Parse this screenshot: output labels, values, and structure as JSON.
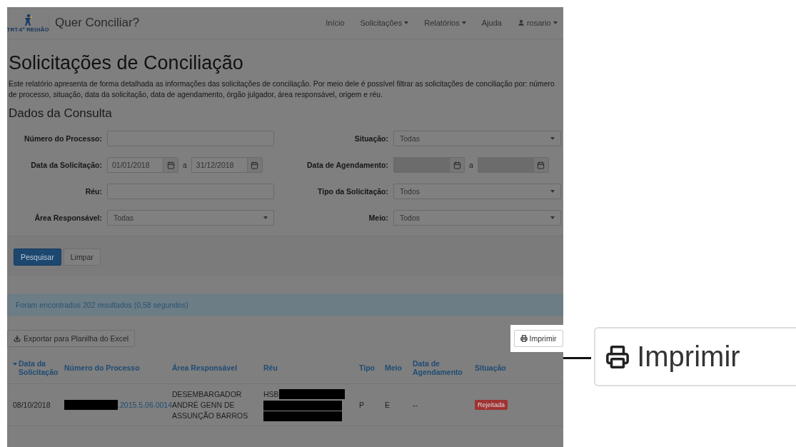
{
  "navbar": {
    "logo_text": "TRT-6ª REGIÃO",
    "brand": "Quer Conciliar?",
    "items": [
      {
        "label": "Início",
        "kind": "link"
      },
      {
        "label": "Solicitações",
        "kind": "dropdown"
      },
      {
        "label": "Relatórios",
        "kind": "dropdown"
      },
      {
        "label": "Ajuda",
        "kind": "link"
      },
      {
        "label": "rosario",
        "kind": "user"
      }
    ]
  },
  "title": "Solicitações de Conciliação",
  "description": "Este relatório apresenta de forma detalhada as informações das solicitações de conciliação. Por meio dele é possível filtrar as solicitações de conciliação por: número de processo, situação, data da solicitação, data de agendamento, órgão julgador, área responsável, origem e réu.",
  "section_title": "Dados da Consulta",
  "form": {
    "rows": [
      [
        {
          "label": "Número do Processo:",
          "kind": "text"
        },
        {
          "label": "Situação:",
          "kind": "select",
          "value": "Todas"
        }
      ],
      [
        {
          "label": "Data da Solicitação:",
          "kind": "daterange",
          "from": "01/01/2018",
          "separator": "a",
          "to": "31/12/2018",
          "disabled": false
        },
        {
          "label": "Data de Agendamento:",
          "kind": "daterange",
          "separator": "a",
          "disabled": true
        }
      ],
      [
        {
          "label": "Réu:",
          "kind": "text"
        },
        {
          "label": "Tipo da Solicitação:",
          "kind": "select",
          "value": "Todos"
        }
      ],
      [
        {
          "label": "Área Responsável:",
          "kind": "select",
          "value": "Todas"
        },
        {
          "label": "Meio:",
          "kind": "select",
          "value": "Todos"
        }
      ]
    ],
    "buttons": [
      {
        "label": "Pesquisar",
        "primary": true
      },
      {
        "label": "Limpar",
        "primary": false
      }
    ]
  },
  "results_message": "Foram encontrados 202 resultados (0,58 segundos)",
  "export_button": "Exportar para Planilha do Excel",
  "print_button": {
    "label": "Imprimir",
    "highlighted": true
  },
  "table": {
    "columns": [
      {
        "label": "Data da Solicitação",
        "sorted": true
      },
      {
        "label": "Número do Processo",
        "sorted": false
      },
      {
        "label": "Área Responsável",
        "sorted": false
      },
      {
        "label": "Réu",
        "sorted": false
      },
      {
        "label": "Tipo",
        "sorted": false
      },
      {
        "label": "Meio",
        "sorted": false
      },
      {
        "label": "Data de Agendamento",
        "sorted": false
      },
      {
        "label": "Situação",
        "sorted": false
      }
    ],
    "rows": [
      {
        "data": "08/10/2018",
        "processo": ".2015.5.06.0014",
        "processo_redacted": true,
        "area": "DESEMBARGADOR ANDRÉ GENN DE ASSUNÇÃO BARROS",
        "reu": [
          {
            "kind": "partial",
            "text": "HSB"
          },
          {
            "kind": "redacted"
          },
          {
            "kind": "redacted"
          }
        ],
        "tipo": "P",
        "meio": "E",
        "agendamento": "--",
        "situacao": "Rejeitada"
      }
    ]
  },
  "callout": {
    "label": "Imprimir"
  }
}
